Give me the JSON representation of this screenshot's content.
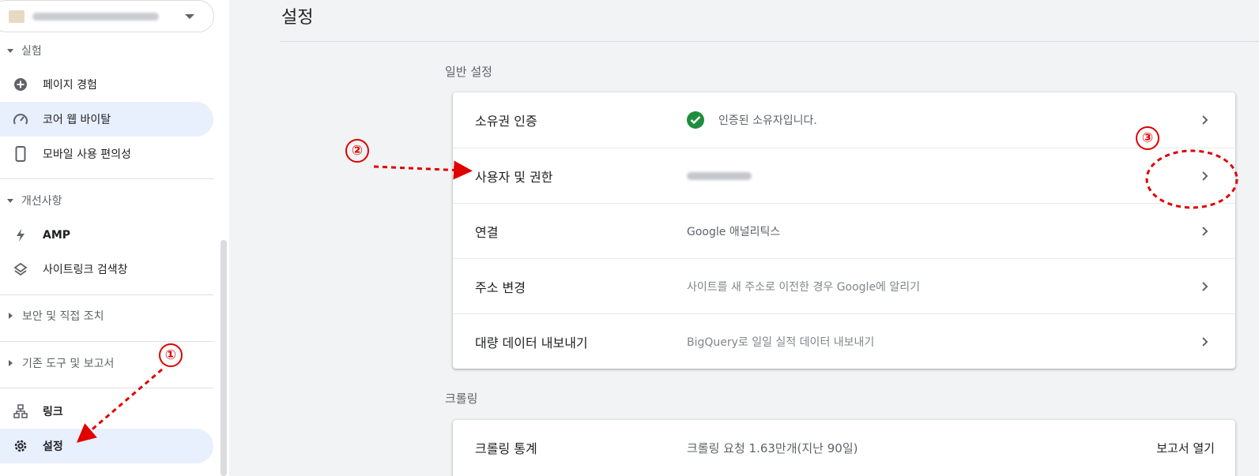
{
  "sidebar": {
    "sections": [
      {
        "header": "실험",
        "items": [
          {
            "label": "페이지 경험",
            "icon": "plus-circle-icon"
          },
          {
            "label": "코어 웹 바이탈",
            "icon": "speed-gauge-icon"
          },
          {
            "label": "모바일 사용 편의성",
            "icon": "smartphone-icon"
          }
        ]
      },
      {
        "header": "개선사항",
        "items": [
          {
            "label": "AMP",
            "icon": "lightning-icon"
          },
          {
            "label": "사이트링크 검색창",
            "icon": "layers-icon"
          }
        ]
      },
      {
        "header": "보안 및 직접 조치"
      },
      {
        "header": "기존 도구 및 보고서"
      }
    ],
    "bottom_items": [
      {
        "label": "링크",
        "icon": "sitemap-icon"
      },
      {
        "label": "설정",
        "icon": "gear-icon"
      }
    ]
  },
  "main": {
    "title": "설정",
    "general": {
      "label": "일반 설정",
      "rows": [
        {
          "label": "소유권 인증",
          "value": "인증된 소유자입니다."
        },
        {
          "label": "사용자 및 권한",
          "value": ""
        },
        {
          "label": "연결",
          "value": "Google 애널리틱스"
        },
        {
          "label": "주소 변경",
          "value": "사이트를 새 주소로 이전한 경우 Google에 알리기"
        },
        {
          "label": "대량 데이터 내보내기",
          "value": "BigQuery로 일일 실적 데이터 내보내기"
        }
      ]
    },
    "crawling": {
      "label": "크롤링",
      "rows": [
        {
          "label": "크롤링 통계",
          "value": "크롤링 요청 1.63만개(지난 90일)",
          "action": "보고서 열기"
        }
      ]
    }
  },
  "annotations": {
    "step1": "①",
    "step2": "②",
    "step3": "③",
    "color": "#e00000"
  }
}
